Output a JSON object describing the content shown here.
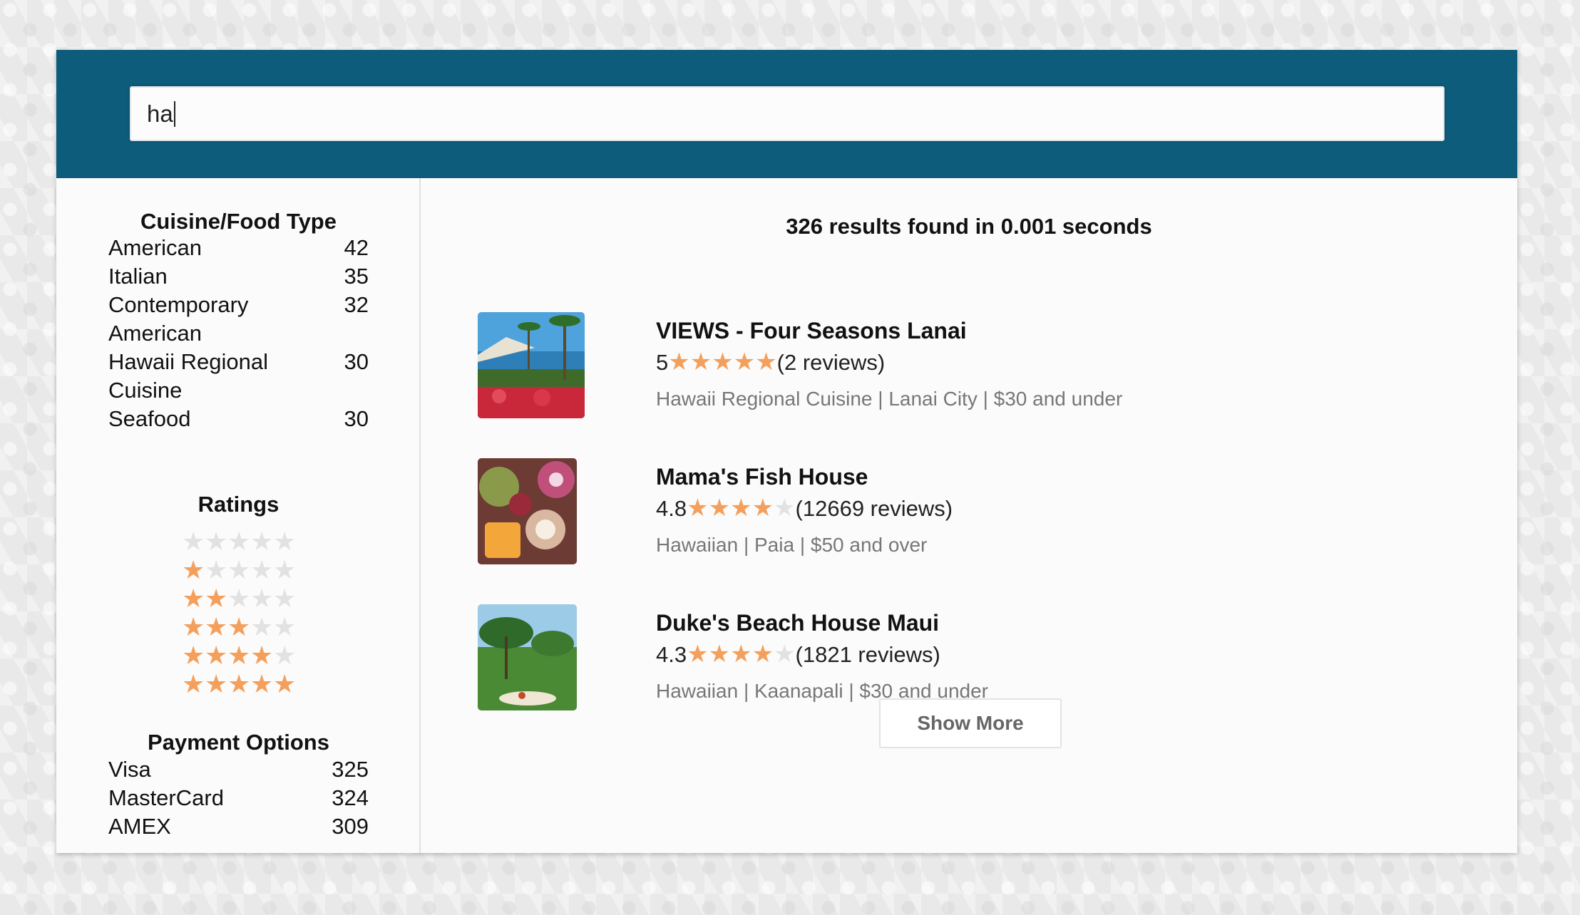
{
  "search": {
    "value": "ha"
  },
  "facets": {
    "cuisine": {
      "title": "Cuisine/Food Type",
      "items": [
        {
          "label": "American",
          "count": "42"
        },
        {
          "label": "Italian",
          "count": "35"
        },
        {
          "label": "Contemporary American",
          "count": "32"
        },
        {
          "label": "Hawaii Regional Cuisine",
          "count": "30"
        },
        {
          "label": "Seafood",
          "count": "30"
        }
      ]
    },
    "ratings": {
      "title": "Ratings",
      "levels": [
        0,
        1,
        2,
        3,
        4,
        5
      ]
    },
    "payment": {
      "title": "Payment Options",
      "items": [
        {
          "label": "Visa",
          "count": "325"
        },
        {
          "label": "MasterCard",
          "count": "324"
        },
        {
          "label": "AMEX",
          "count": "309"
        }
      ]
    }
  },
  "results": {
    "summary": "326 results found in 0.001 seconds",
    "items": [
      {
        "name": "VIEWS - Four Seasons Lanai",
        "rating": "5",
        "stars": 5,
        "reviews": "(2 reviews)",
        "meta": "Hawaii Regional Cuisine | Lanai City | $30 and under"
      },
      {
        "name": "Mama's Fish House",
        "rating": "4.8",
        "stars": 4,
        "reviews": "(12669 reviews)",
        "meta": "Hawaiian | Paia | $50 and over"
      },
      {
        "name": "Duke's Beach House Maui",
        "rating": "4.3",
        "stars": 4,
        "reviews": "(1821 reviews)",
        "meta": "Hawaiian | Kaanapali | $30 and under"
      }
    ]
  },
  "show_more_label": "Show More",
  "colors": {
    "header": "#0e5c7c",
    "star_on": "#f4a05c",
    "star_off": "#e2e2e2"
  }
}
